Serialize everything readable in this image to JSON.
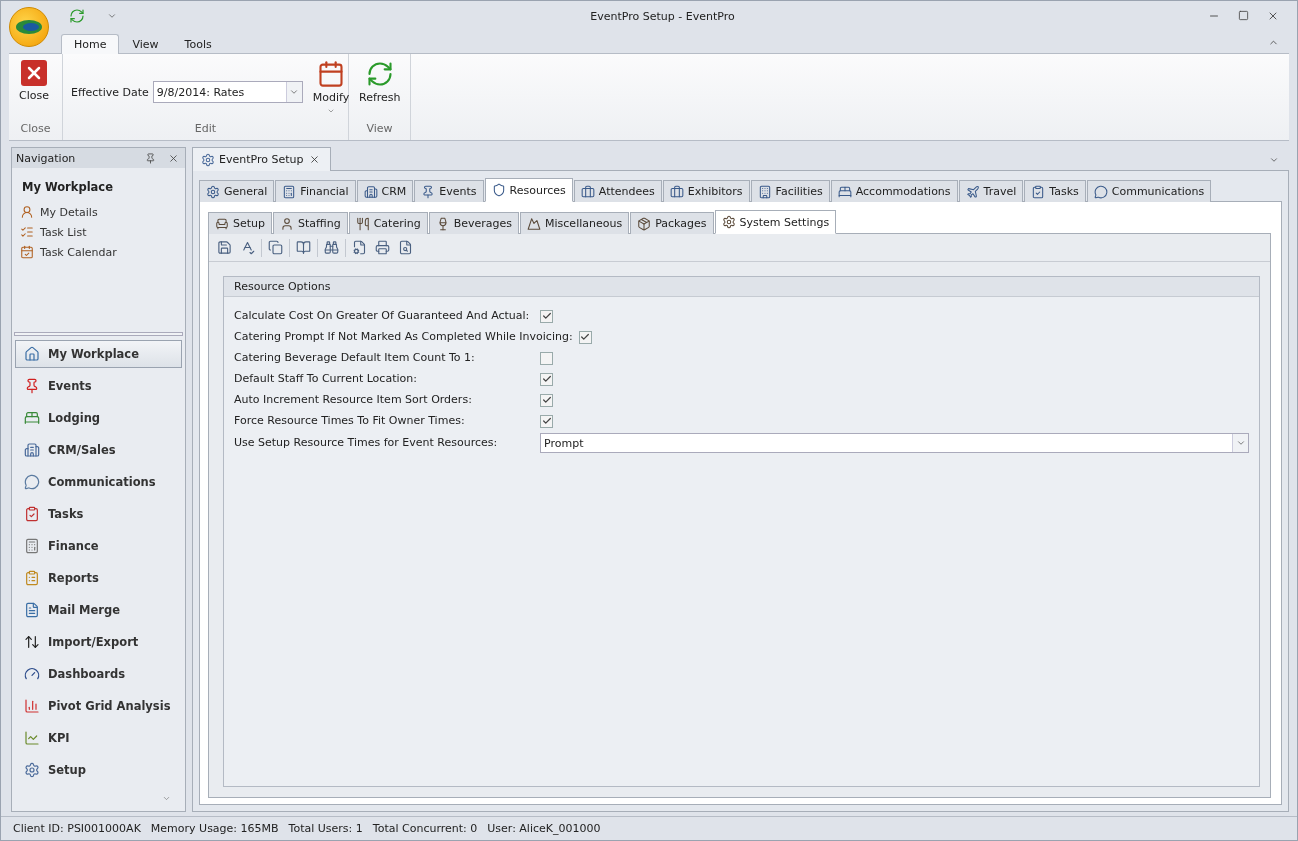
{
  "window": {
    "title": "EventPro Setup - EventPro"
  },
  "ribbon": {
    "tabs": [
      {
        "label": "Home",
        "selected": true
      },
      {
        "label": "View",
        "selected": false
      },
      {
        "label": "Tools",
        "selected": false
      }
    ],
    "close_group": {
      "button": "Close",
      "caption": "Close"
    },
    "edit_group": {
      "field_label": "Effective Date",
      "field_value": "9/8/2014: Rates",
      "button": "Modify",
      "caption": "Edit"
    },
    "view_group": {
      "button": "Refresh",
      "caption": "View"
    }
  },
  "navigation": {
    "title": "Navigation",
    "heading": "My Workplace",
    "links": [
      "My Details",
      "Task List",
      "Task Calendar"
    ],
    "modules": [
      {
        "label": "My Workplace",
        "selected": true
      },
      {
        "label": "Events",
        "selected": false
      },
      {
        "label": "Lodging",
        "selected": false
      },
      {
        "label": "CRM/Sales",
        "selected": false
      },
      {
        "label": "Communications",
        "selected": false
      },
      {
        "label": "Tasks",
        "selected": false
      },
      {
        "label": "Finance",
        "selected": false
      },
      {
        "label": "Reports",
        "selected": false
      },
      {
        "label": "Mail Merge",
        "selected": false
      },
      {
        "label": "Import/Export",
        "selected": false
      },
      {
        "label": "Dashboards",
        "selected": false
      },
      {
        "label": "Pivot Grid Analysis",
        "selected": false
      },
      {
        "label": "KPI",
        "selected": false
      },
      {
        "label": "Setup",
        "selected": false
      }
    ]
  },
  "document_tab": {
    "label": "EventPro Setup"
  },
  "main_tabs": [
    {
      "label": "General",
      "selected": false
    },
    {
      "label": "Financial",
      "selected": false
    },
    {
      "label": "CRM",
      "selected": false
    },
    {
      "label": "Events",
      "selected": false
    },
    {
      "label": "Resources",
      "selected": true
    },
    {
      "label": "Attendees",
      "selected": false
    },
    {
      "label": "Exhibitors",
      "selected": false
    },
    {
      "label": "Facilities",
      "selected": false
    },
    {
      "label": "Accommodations",
      "selected": false
    },
    {
      "label": "Travel",
      "selected": false
    },
    {
      "label": "Tasks",
      "selected": false
    },
    {
      "label": "Communications",
      "selected": false
    }
  ],
  "sub_tabs": [
    {
      "label": "Setup",
      "selected": false
    },
    {
      "label": "Staffing",
      "selected": false
    },
    {
      "label": "Catering",
      "selected": false
    },
    {
      "label": "Beverages",
      "selected": false
    },
    {
      "label": "Miscellaneous",
      "selected": false
    },
    {
      "label": "Packages",
      "selected": false
    },
    {
      "label": "System Settings",
      "selected": true
    }
  ],
  "resource_options": {
    "title": "Resource Options",
    "options": [
      {
        "kind": "checkbox",
        "label": "Calculate Cost On Greater Of Guaranteed And Actual:",
        "checked": true
      },
      {
        "kind": "checkbox",
        "label": "Catering Prompt If Not Marked As Completed While Invoicing:",
        "checked": true
      },
      {
        "kind": "checkbox",
        "label": "Catering Beverage Default Item Count To 1:",
        "checked": false
      },
      {
        "kind": "checkbox",
        "label": "Default Staff To Current Location:",
        "checked": true
      },
      {
        "kind": "checkbox",
        "label": "Auto Increment Resource Item Sort Orders:",
        "checked": true
      },
      {
        "kind": "checkbox",
        "label": "Force Resource Times To Fit Owner Times:",
        "checked": true
      },
      {
        "kind": "dropdown",
        "label": "Use Setup Resource Times for Event Resources:",
        "value": "Prompt"
      }
    ]
  },
  "status_bar": [
    "Client ID: PSI001000AK",
    "Memory Usage: 165MB",
    "Total Users: 1",
    "Total Concurrent: 0",
    "User: AliceK_001000"
  ]
}
